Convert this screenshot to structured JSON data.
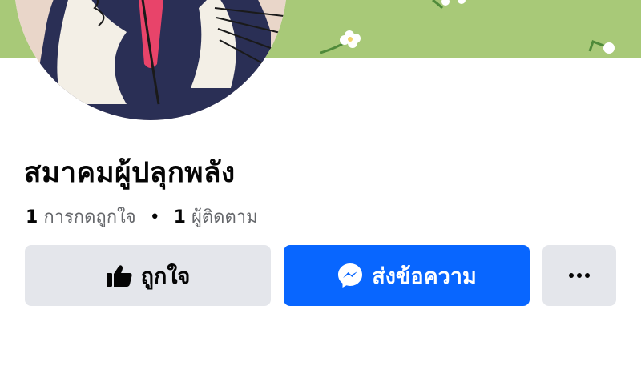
{
  "page": {
    "name": "สมาคมผู้ปลุกพลัง",
    "stats": {
      "likes_count": "1",
      "likes_label": "การกดถูกใจ",
      "separator": "•",
      "followers_count": "1",
      "followers_label": "ผู้ติดตาม"
    }
  },
  "actions": {
    "like_label": "ถูกใจ",
    "message_label": "ส่งข้อความ",
    "more_icon": "more-horizontal-icon"
  },
  "colors": {
    "cover": "#a8c978",
    "primary": "#0866ff",
    "secondary_button": "#e4e6eb",
    "text_primary": "#050505",
    "text_secondary": "#65676b"
  }
}
